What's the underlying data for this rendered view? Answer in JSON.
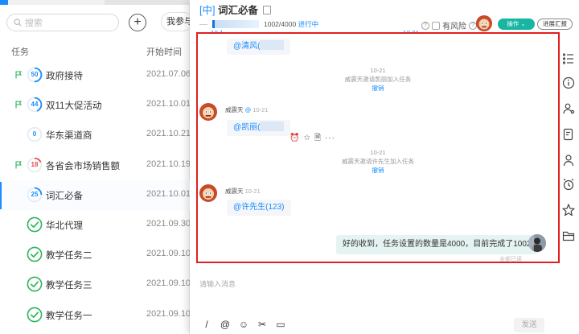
{
  "search": {
    "placeholder": "搜索"
  },
  "toolbar": {
    "add_label": "+",
    "my_label": "我参与的"
  },
  "list": {
    "headers": {
      "task": "任务",
      "start": "开始时间"
    },
    "rows": [
      {
        "badge": "50",
        "name": "政府接待",
        "date": "2021.07.06",
        "flag": true,
        "badge_color": "#1a8cff",
        "progress": 0.5,
        "done": false
      },
      {
        "badge": "44",
        "name": "双11大促活动",
        "date": "2021.10.01",
        "flag": true,
        "badge_color": "#1a8cff",
        "progress": 0.44,
        "done": false
      },
      {
        "badge": "0",
        "name": "华东渠道商",
        "date": "2021.10.21",
        "flag": false,
        "badge_color": "#1a8cff",
        "progress": 0.0,
        "done": false
      },
      {
        "badge": "18",
        "name": "各省会市场销售额",
        "date": "2021.10.19",
        "flag": true,
        "badge_color": "#e84b4b",
        "progress": 0.18,
        "done": false
      },
      {
        "badge": "25",
        "name": "词汇必备",
        "date": "2021.10.01",
        "flag": false,
        "badge_color": "#1a8cff",
        "progress": 0.25,
        "done": false
      },
      {
        "badge": "",
        "name": "华北代理",
        "date": "2021.09.30",
        "flag": false,
        "badge_color": "#2cb45a",
        "progress": 1,
        "done": true
      },
      {
        "badge": "",
        "name": "教学任务二",
        "date": "2021.09.10",
        "flag": false,
        "badge_color": "#2cb45a",
        "progress": 1,
        "done": true
      },
      {
        "badge": "",
        "name": "教学任务三",
        "date": "2021.09.10",
        "flag": false,
        "badge_color": "#2cb45a",
        "progress": 1,
        "done": true
      },
      {
        "badge": "",
        "name": "教学任务一",
        "date": "2021.09.10",
        "flag": false,
        "badge_color": "#2cb45a",
        "progress": 1,
        "done": true
      }
    ]
  },
  "detail": {
    "category": "[中]",
    "title": "词汇必备",
    "progress_text": "1002/4000",
    "status": "进行中",
    "progress": 0.25,
    "start_date": "10.1",
    "end_date": "10.31",
    "risk_label": "有风险",
    "operate_label": "操作 ⌄",
    "report_label": "进展汇报"
  },
  "chat": {
    "messages": [
      {
        "type": "bubble",
        "text": "@清风("
      },
      {
        "type": "system",
        "date": "10-21",
        "text": "威震天邀请凯丽加入任务",
        "revoke": "撤销"
      },
      {
        "type": "user",
        "sender": "威震天",
        "at": "@",
        "time": "10-21",
        "text": "@凯丽("
      },
      {
        "type": "system",
        "date": "10-21",
        "text": "威震天邀请许先生加入任务",
        "revoke": "撤销"
      },
      {
        "type": "user",
        "sender": "威震天",
        "time": "10-21",
        "text": "@许先生(123)"
      },
      {
        "type": "mine",
        "text": "好的收到，任务设置的数量是4000，目前完成了1002",
        "read": "全部已读"
      }
    ],
    "hover_tools": "⏰ ☆ 🗎 ···",
    "input_placeholder": "请输入消息",
    "send_label": "发送",
    "tools": [
      "/",
      "@",
      "☺",
      "✂",
      "▭"
    ]
  },
  "colors": {
    "accent": "#1a8cff",
    "teal": "#17b6a2",
    "highlight_border": "#e02020",
    "done": "#2cb45a",
    "risk": "#e84b4b"
  }
}
